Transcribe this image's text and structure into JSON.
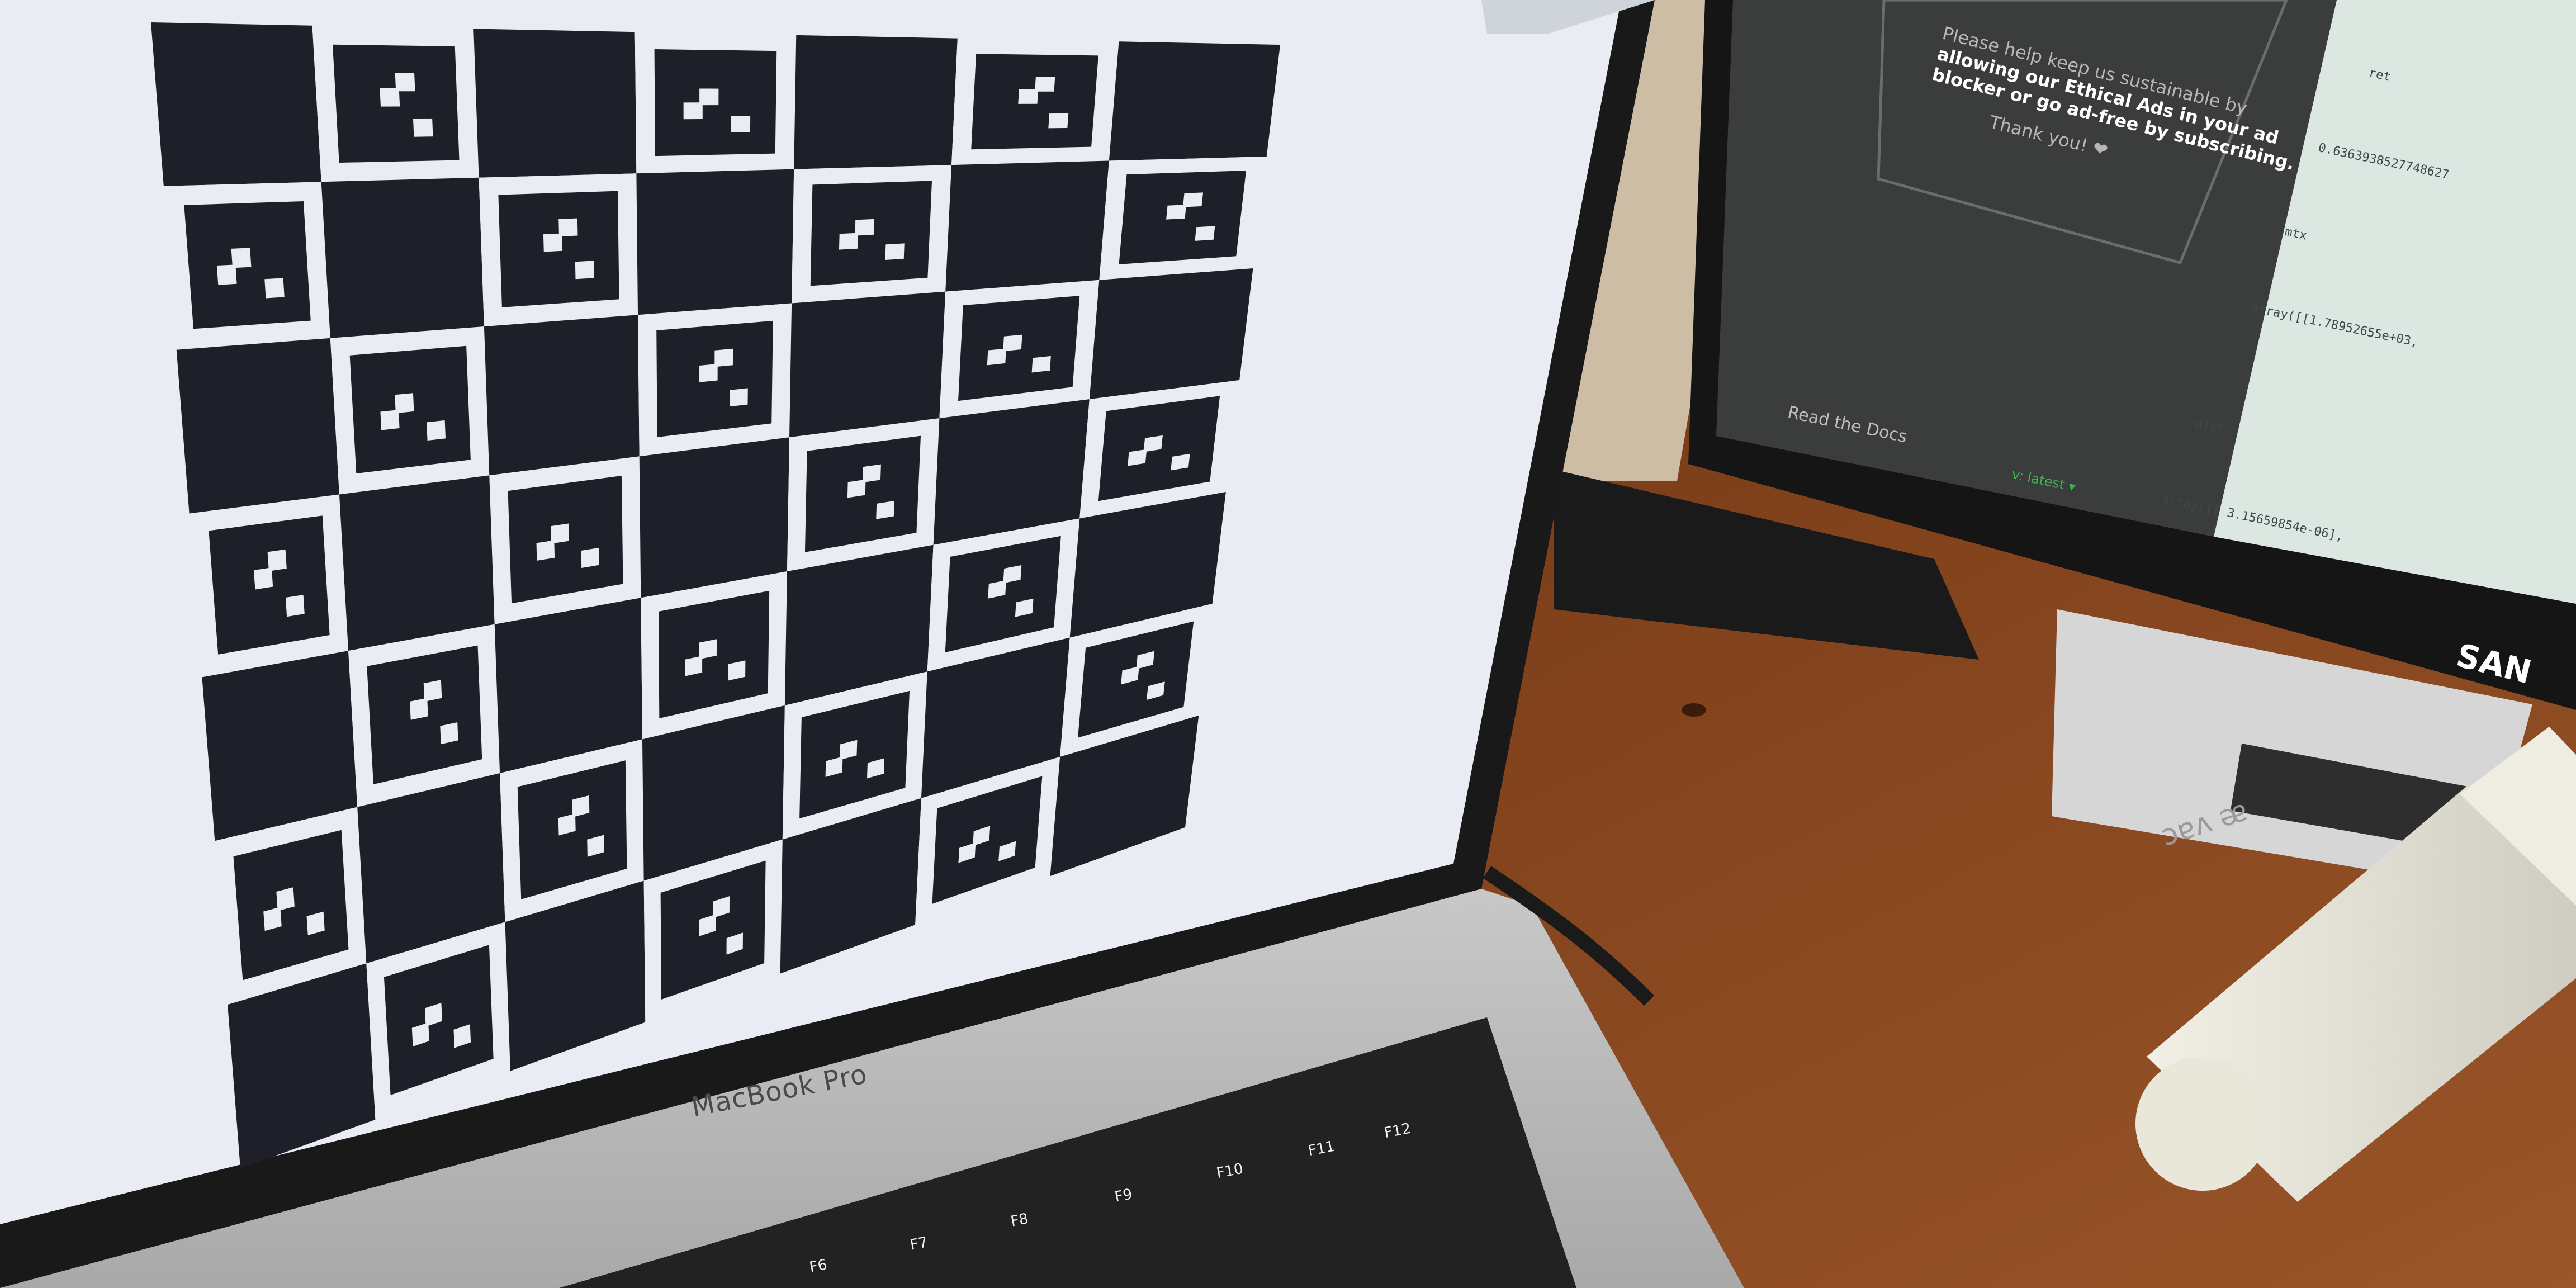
{
  "laptop": {
    "brand": "MacBook Pro",
    "screen_content": "ArUco marker checkerboard",
    "keys": [
      "F6",
      "F7",
      "F8",
      "F9",
      "F10",
      "F11",
      "F12"
    ]
  },
  "monitor": {
    "brand_label": "SAN",
    "ad_banner": {
      "lines": [
        "Please help keep us sustainable by",
        "allowing our Ethical Ads in your ad",
        "blocker or go ad-free by subscribing.",
        "Thank you! ❤"
      ]
    },
    "footer_label": "Read the Docs",
    "version_label": "v: latest ▾",
    "doc_lines": [
      "ret",
      "0.6363938527748627",
      "mtx",
      "array([[1.78952655e+03,",
      "dist",
      "array([[ 3.15659854e-06],"
    ]
  },
  "device_box_label": "æ vac",
  "colors": {
    "marker_black": "#1f1f2a",
    "screen_white": "#e9ecf2",
    "desk_wood": "#8a4a22"
  }
}
